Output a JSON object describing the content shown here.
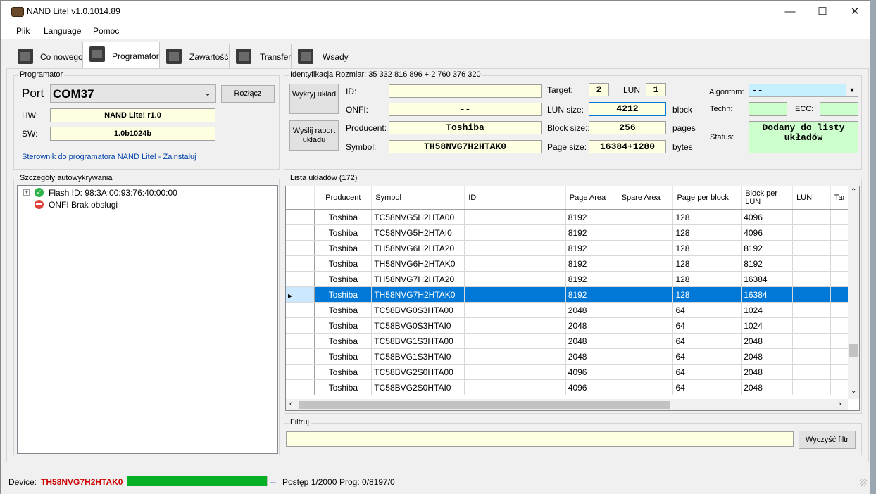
{
  "window": {
    "title": "NAND Lite! v1.0.1014.89"
  },
  "menu": [
    "Plik",
    "Language",
    "Pomoc"
  ],
  "tabs": [
    {
      "label": "Co nowego"
    },
    {
      "label": "Programator"
    },
    {
      "label": "Zawartość"
    },
    {
      "label": "Transfer"
    },
    {
      "label": "Wsady"
    }
  ],
  "programator": {
    "group_title": "Programator",
    "port_label": "Port",
    "port_value": "COM37",
    "disconnect_label": "Rozłącz",
    "hw_label": "HW:",
    "hw_value": "NAND Lite! r1.0",
    "sw_label": "SW:",
    "sw_value": "1.0b1024b",
    "driver_link": "Sterownik do programatora NAND Lite! - Zainstaluj"
  },
  "identification": {
    "group_title": "Identyfikacja Rozmiar: 35 332 816 896 + 2 760 376 320",
    "detect_label": "Wykryj układ",
    "send_report_label": "Wyślij raport układu",
    "id_label": "ID:",
    "id_value": "",
    "onfi_label": "ONFI:",
    "onfi_value": "--",
    "producer_label": "Producent:",
    "producer_value": "Toshiba",
    "symbol_label": "Symbol:",
    "symbol_value": "TH58NVG7H2HTAK0",
    "target_label": "Target:",
    "target_value": "2",
    "lun_label": "LUN",
    "lun_value": "1",
    "lun_size_label": "LUN size:",
    "lun_size_value": "4212",
    "lun_size_unit": "block",
    "block_size_label": "Block size::",
    "block_size_value": "256",
    "block_size_unit": "pages",
    "page_size_label": "Page size:",
    "page_size_value": "16384+1280",
    "page_size_unit": "bytes",
    "algorithm_label": "Algorithm:",
    "algorithm_value": "--",
    "techn_label": "Techn:",
    "techn_value": "",
    "ecc_label": "ECC:",
    "ecc_value": "",
    "status_label": "Status:",
    "status_value": "Dodany do listy układów"
  },
  "autodetect": {
    "group_title": "Szczegóły autowykrywania",
    "items": [
      {
        "text": "Flash ID: 98:3A:00:93:76:40:00:00",
        "icon": "check-icon"
      },
      {
        "text": "ONFI Brak obsługi",
        "icon": "no-entry-icon"
      }
    ]
  },
  "chip_list": {
    "group_title": "Lista układów (172)",
    "columns": [
      "Producent",
      "Symbol",
      "ID",
      "Page Area",
      "Spare Area",
      "Page per block",
      "Block per LUN",
      "LUN",
      "Tar"
    ],
    "rows": [
      [
        "Toshiba",
        "TC58NVG5H2HTA00",
        "",
        "8192",
        "",
        "128",
        "4096",
        "",
        ""
      ],
      [
        "Toshiba",
        "TC58NVG5H2HTAI0",
        "",
        "8192",
        "",
        "128",
        "4096",
        "",
        ""
      ],
      [
        "Toshiba",
        "TH58NVG6H2HTA20",
        "",
        "8192",
        "",
        "128",
        "8192",
        "",
        ""
      ],
      [
        "Toshiba",
        "TH58NVG6H2HTAK0",
        "",
        "8192",
        "",
        "128",
        "8192",
        "",
        ""
      ],
      [
        "Toshiba",
        "TH58NVG7H2HTA20",
        "",
        "8192",
        "",
        "128",
        "16384",
        "",
        ""
      ],
      [
        "Toshiba",
        "TH58NVG7H2HTAK0",
        "",
        "8192",
        "",
        "128",
        "16384",
        "",
        ""
      ],
      [
        "Toshiba",
        "TC58BVG0S3HTA00",
        "",
        "2048",
        "",
        "64",
        "1024",
        "",
        ""
      ],
      [
        "Toshiba",
        "TC58BVG0S3HTAI0",
        "",
        "2048",
        "",
        "64",
        "1024",
        "",
        ""
      ],
      [
        "Toshiba",
        "TC58BVG1S3HTA00",
        "",
        "2048",
        "",
        "64",
        "2048",
        "",
        ""
      ],
      [
        "Toshiba",
        "TC58BVG1S3HTAI0",
        "",
        "2048",
        "",
        "64",
        "2048",
        "",
        ""
      ],
      [
        "Toshiba",
        "TC58BVG2S0HTA00",
        "",
        "4096",
        "",
        "64",
        "2048",
        "",
        ""
      ],
      [
        "Toshiba",
        "TC58BVG2S0HTAI0",
        "",
        "4096",
        "",
        "64",
        "2048",
        "",
        ""
      ]
    ],
    "selected_row": 5
  },
  "filter": {
    "group_title": "Filtruj",
    "value": "",
    "clear_label": "Wyczyść filtr"
  },
  "status": {
    "device_label": "Device:",
    "device_value": "TH58NVG7H2HTAK0",
    "progress_fraction": 1.0,
    "dashes": "--",
    "progress_text": "Postęp 1/2000",
    "prog_text": "Prog: 0/8197/0"
  },
  "colors": {
    "selection": "#0078d7",
    "field": "#ffffe1",
    "status_green": "#ccffcc",
    "device_red": "#cc0000",
    "progress": "#06b025"
  }
}
